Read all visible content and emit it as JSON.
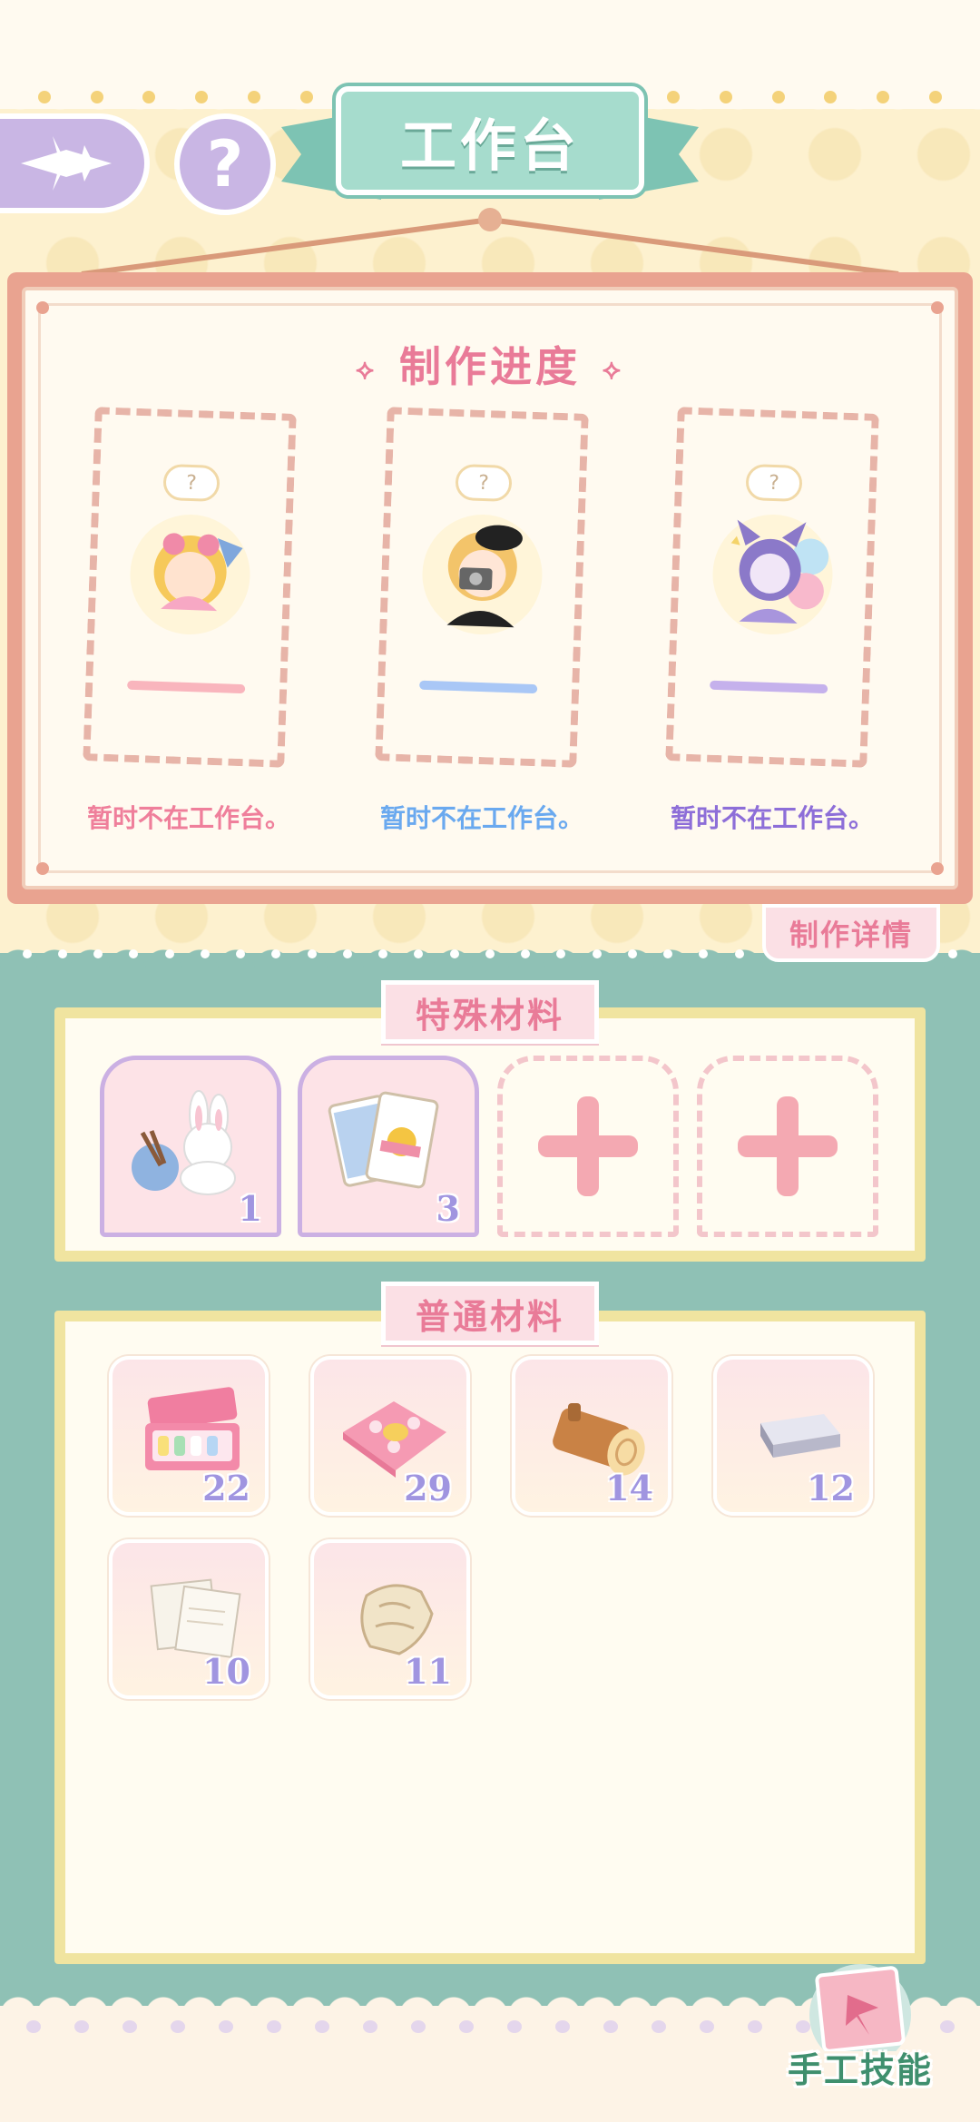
{
  "header": {
    "title": "工作台",
    "help_symbol": "?"
  },
  "progress": {
    "title": "制作进度",
    "slots": [
      {
        "status": "暂时不在工作台。",
        "color": "#ef7f9b",
        "bar_color": "#f9b5bd",
        "thought": "?"
      },
      {
        "status": "暂时不在工作台。",
        "color": "#6aa9ef",
        "bar_color": "#a9c7f6",
        "thought": "?"
      },
      {
        "status": "暂时不在工作台。",
        "color": "#8d6ed8",
        "bar_color": "#c5b1ec",
        "thought": "?"
      }
    ],
    "details_tab": "制作详情"
  },
  "special_materials": {
    "title": "特殊材料",
    "items": [
      {
        "icon": "bunny-plush-icon",
        "count": "1"
      },
      {
        "icon": "playing-cards-icon",
        "count": "3"
      }
    ],
    "empty_slots": 2
  },
  "common_materials": {
    "title": "普通材料",
    "items": [
      {
        "icon": "paint-box-icon",
        "count": "22"
      },
      {
        "icon": "pink-fabric-icon",
        "count": "29"
      },
      {
        "icon": "wood-log-icon",
        "count": "14"
      },
      {
        "icon": "silver-ingot-icon",
        "count": "12"
      },
      {
        "icon": "paper-sheets-icon",
        "count": "10"
      },
      {
        "icon": "fur-pelt-icon",
        "count": "11"
      }
    ]
  },
  "footer": {
    "skill_button": "手工技能"
  },
  "colors": {
    "accent_pink": "#e97b98",
    "teal": "#8fc1b5",
    "ribbon": "#a6dccd",
    "lavender": "#c9b6e4"
  }
}
